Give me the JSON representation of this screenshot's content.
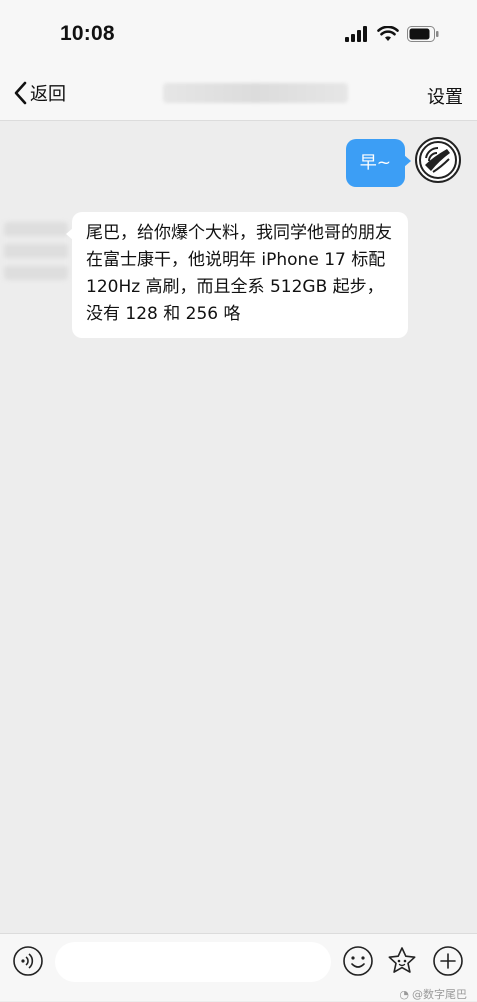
{
  "status_bar": {
    "time": "10:08"
  },
  "nav": {
    "back_label": "返回",
    "settings_label": "设置"
  },
  "messages": {
    "outgoing": "早~",
    "incoming": "尾巴，给你爆个大料，我同学他哥的朋友在富士康干，他说明年 iPhone 17 标配 120Hz 高刷，而且全系 512GB 起步，没有 128 和 256 咯"
  },
  "input": {
    "placeholder": ""
  },
  "icons": {
    "signal": "signal-icon",
    "wifi": "wifi-icon",
    "battery": "battery-icon",
    "back": "chevron-left-icon",
    "voice": "voice-icon",
    "emoji": "emoji-icon",
    "sticker": "star-sticker-icon",
    "plus": "plus-icon"
  },
  "watermark": "@数字尾巴",
  "colors": {
    "accent": "#3c9ef5",
    "background": "#ededed"
  }
}
